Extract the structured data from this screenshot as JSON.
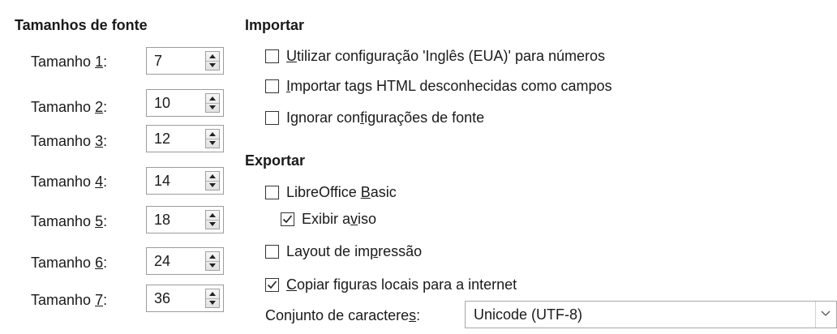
{
  "font_sizes": {
    "heading": "Tamanhos de fonte",
    "rows": [
      {
        "pre": "Tamanho ",
        "key": "1",
        "post": ":",
        "value": "7"
      },
      {
        "pre": "Tamanho ",
        "key": "2",
        "post": ":",
        "value": "10"
      },
      {
        "pre": "Tamanho ",
        "key": "3",
        "post": ":",
        "value": "12"
      },
      {
        "pre": "Tamanho ",
        "key": "4",
        "post": ":",
        "value": "14"
      },
      {
        "pre": "Tamanho ",
        "key": "5",
        "post": ":",
        "value": "18"
      },
      {
        "pre": "Tamanho ",
        "key": "6",
        "post": ":",
        "value": "24"
      },
      {
        "pre": "Tamanho ",
        "key": "7",
        "post": ":",
        "value": "36"
      }
    ]
  },
  "import": {
    "heading": "Importar",
    "options": [
      {
        "pre": "",
        "key": "U",
        "post": "tilizar configuração 'Inglês (EUA)' para números",
        "checked": false
      },
      {
        "pre": "",
        "key": "I",
        "post": "mportar tags HTML desconhecidas como campos",
        "checked": false
      },
      {
        "pre": "Ignorar con",
        "key": "f",
        "post": "igurações de fonte",
        "checked": false
      }
    ]
  },
  "export": {
    "heading": "Exportar",
    "options": [
      {
        "pre": "LibreOffice ",
        "key": "B",
        "post": "asic",
        "checked": false
      },
      {
        "pre": "Exibir a",
        "key": "v",
        "post": "iso",
        "checked": true
      },
      {
        "pre": "Layout de im",
        "key": "p",
        "post": "ressão",
        "checked": false
      },
      {
        "pre": "",
        "key": "C",
        "post": "opiar figuras locais para a internet",
        "checked": true
      }
    ],
    "charset": {
      "label_pre": "Conjunto de caractere",
      "label_key": "s",
      "label_post": ":",
      "value": "Unicode (UTF-8)"
    }
  },
  "icons": {
    "spin_up": "spin-up-icon",
    "spin_down": "spin-down-icon",
    "checkmark": "checkmark-icon",
    "dropdown": "chevron-down-icon"
  }
}
